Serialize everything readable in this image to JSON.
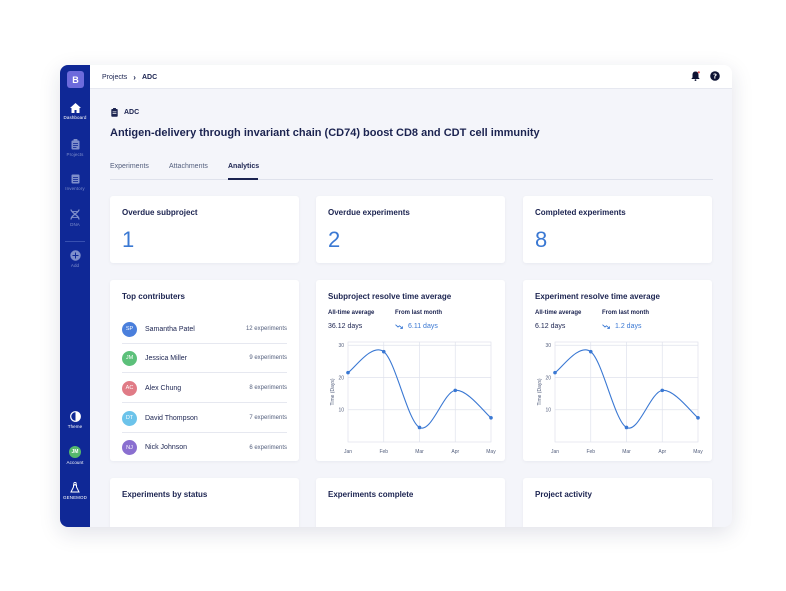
{
  "sidebar": {
    "brand": "B",
    "items": [
      {
        "label": "Dashboard",
        "icon": "home-icon"
      },
      {
        "label": "Projects",
        "icon": "clipboard-icon"
      },
      {
        "label": "Inventory",
        "icon": "inventory-icon"
      },
      {
        "label": "DNA",
        "icon": "dna-icon"
      },
      {
        "label": "Add",
        "icon": "add-icon"
      }
    ],
    "theme_label": "Theme",
    "account_label": "Account",
    "account_initials": "JM",
    "logo_label": "GENEMOD"
  },
  "breadcrumb": {
    "root": "Projects",
    "current": "ADC"
  },
  "project": {
    "tag": "ADC",
    "title": "Antigen-delivery through invariant chain (CD74) boost CD8 and CDT cell immunity"
  },
  "tabs": [
    "Experiments",
    "Attachments",
    "Analytics"
  ],
  "active_tab": "Analytics",
  "stats": [
    {
      "title": "Overdue subproject",
      "value": "1"
    },
    {
      "title": "Overdue experiments",
      "value": "2"
    },
    {
      "title": "Completed experiments",
      "value": "8"
    }
  ],
  "contributors": {
    "title": "Top contributers",
    "people": [
      {
        "initials": "SP",
        "name": "Samantha Patel",
        "count": "12 experiments",
        "color": "#4a7fdc"
      },
      {
        "initials": "JM",
        "name": "Jessica Miller",
        "count": "9 experiments",
        "color": "#5cc07a"
      },
      {
        "initials": "AC",
        "name": "Alex Chung",
        "count": "8 experiments",
        "color": "#e07b86"
      },
      {
        "initials": "DT",
        "name": "David Thompson",
        "count": "7 experiments",
        "color": "#6cc3ea"
      },
      {
        "initials": "NJ",
        "name": "Nick Johnson",
        "count": "6 experiments",
        "color": "#8a6fd0"
      }
    ]
  },
  "subproject_panel": {
    "title": "Subproject resolve time average",
    "avg_label": "All-time average",
    "avg_value": "36.12 days",
    "change_label": "From last month",
    "change_value": "6.11 days"
  },
  "experiment_panel": {
    "title": "Experiment resolve time average",
    "avg_label": "All-time average",
    "avg_value": "6.12 days",
    "change_label": "From last month",
    "change_value": "1.2 days"
  },
  "bottom_cards": [
    "Experiments by status",
    "Experiments complete",
    "Project activity"
  ],
  "colors": {
    "sidebar": "#0f2896",
    "accent": "#3a78d3",
    "text": "#1b2350"
  },
  "chart_data": [
    {
      "type": "line",
      "x": [
        "Jan",
        "Feb",
        "Mar",
        "Apr",
        "May"
      ],
      "series": [
        {
          "values": [
            21.5,
            28,
            4.5,
            16,
            7.5
          ]
        }
      ],
      "yticks": [
        10,
        20,
        30
      ],
      "ylim": [
        0,
        31
      ],
      "ylabel": "Time (Days)",
      "xlabel": ""
    },
    {
      "type": "line",
      "x": [
        "Jan",
        "Feb",
        "Mar",
        "Apr",
        "May"
      ],
      "series": [
        {
          "values": [
            21.5,
            28,
            4.5,
            16,
            7.5
          ]
        }
      ],
      "yticks": [
        10,
        20,
        30
      ],
      "ylim": [
        0,
        31
      ],
      "ylabel": "Time (Days)",
      "xlabel": ""
    }
  ]
}
